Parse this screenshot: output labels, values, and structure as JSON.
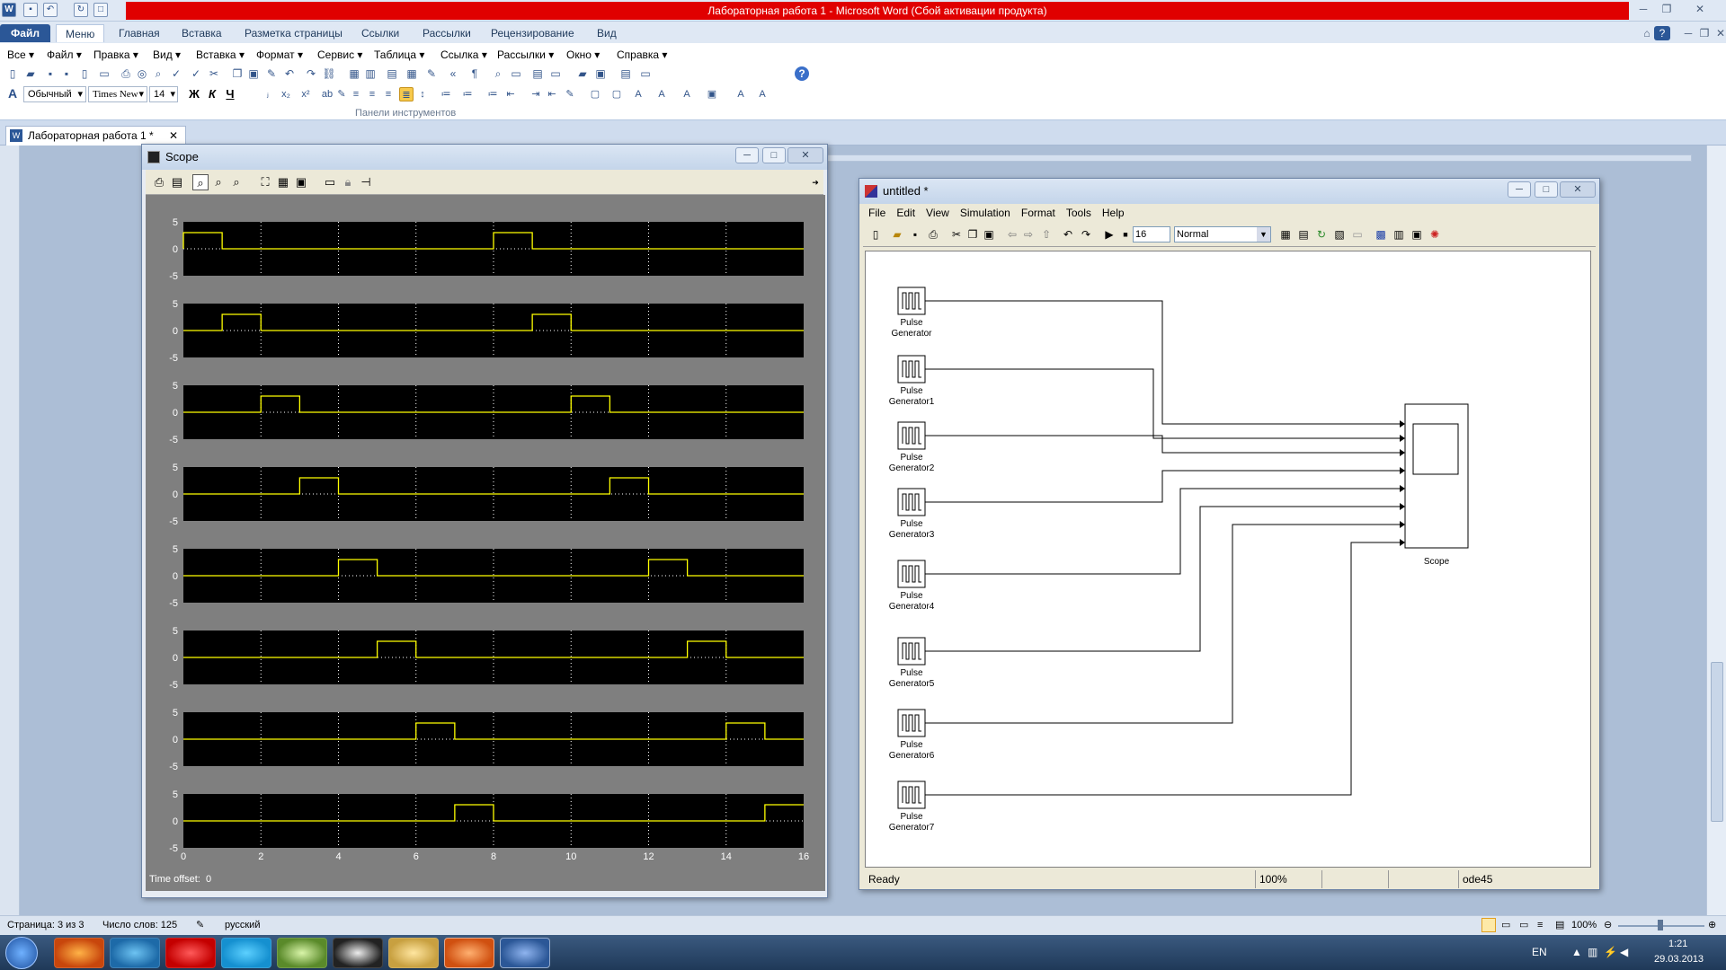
{
  "word": {
    "title": "Лабораторная работа 1  -  Microsoft Word (Сбой активации продукта)",
    "tabs": [
      "Файл",
      "Меню",
      "Главная",
      "Вставка",
      "Разметка страницы",
      "Ссылки",
      "Рассылки",
      "Рецензирование",
      "Вид"
    ],
    "menu_items": [
      "Все",
      "Файл",
      "Правка",
      "Вид",
      "Вставка",
      "Формат",
      "Сервис",
      "Таблица",
      "Ссылка",
      "Рассылки",
      "Окно",
      "Справка"
    ],
    "style_value": "Обычный",
    "font_value": "Times New",
    "size_value": "14",
    "bold_glyph": "Ж",
    "italic_glyph": "К",
    "underline_glyph": "Ч",
    "panel_label": "Панели инструментов",
    "doc_tab": "Лабораторная работа 1  *",
    "status": {
      "page": "Страница: 3 из 3",
      "words": "Число слов: 125",
      "lang": "русский",
      "zoom": "100%"
    }
  },
  "scope": {
    "title": "Scope",
    "time_offset_label": "Time offset:",
    "time_offset_value": "0",
    "y_ticks": [
      "5",
      "0",
      "-5"
    ],
    "x_ticks": [
      "0",
      "2",
      "4",
      "6",
      "8",
      "10",
      "12",
      "14",
      "16"
    ]
  },
  "chart_data": {
    "type": "line",
    "title": "",
    "xlabel": "",
    "ylabel": "",
    "xlim": [
      0,
      16
    ],
    "ylim": [
      -5,
      5
    ],
    "grid": true,
    "line_color": "#ffff00",
    "series": [
      {
        "x": [
          0,
          0,
          1,
          1,
          8,
          8,
          9,
          9,
          16
        ],
        "y": [
          0,
          3,
          3,
          0,
          0,
          3,
          3,
          0,
          0
        ]
      },
      {
        "x": [
          0,
          1,
          1,
          2,
          2,
          9,
          9,
          10,
          10,
          16
        ],
        "y": [
          0,
          0,
          3,
          3,
          0,
          0,
          3,
          3,
          0,
          0
        ]
      },
      {
        "x": [
          0,
          2,
          2,
          3,
          3,
          10,
          10,
          11,
          11,
          16
        ],
        "y": [
          0,
          0,
          3,
          3,
          0,
          0,
          3,
          3,
          0,
          0
        ]
      },
      {
        "x": [
          0,
          3,
          3,
          4,
          4,
          11,
          11,
          12,
          12,
          16
        ],
        "y": [
          0,
          0,
          3,
          3,
          0,
          0,
          3,
          3,
          0,
          0
        ]
      },
      {
        "x": [
          0,
          4,
          4,
          5,
          5,
          12,
          12,
          13,
          13,
          16
        ],
        "y": [
          0,
          0,
          3,
          3,
          0,
          0,
          3,
          3,
          0,
          0
        ]
      },
      {
        "x": [
          0,
          5,
          5,
          6,
          6,
          13,
          13,
          14,
          14,
          16
        ],
        "y": [
          0,
          0,
          3,
          3,
          0,
          0,
          3,
          3,
          0,
          0
        ]
      },
      {
        "x": [
          0,
          6,
          6,
          7,
          7,
          14,
          14,
          15,
          15,
          16
        ],
        "y": [
          0,
          0,
          3,
          3,
          0,
          0,
          3,
          3,
          0,
          0
        ]
      },
      {
        "x": [
          0,
          7,
          7,
          8,
          8,
          15,
          15,
          16
        ],
        "y": [
          0,
          0,
          3,
          3,
          0,
          0,
          3,
          3
        ]
      }
    ]
  },
  "simulink": {
    "title": "untitled *",
    "menu": [
      "File",
      "Edit",
      "View",
      "Simulation",
      "Format",
      "Tools",
      "Help"
    ],
    "stop_time": "16",
    "mode": "Normal",
    "blocks": [
      {
        "l1": "Pulse",
        "l2": "Generator"
      },
      {
        "l1": "Pulse",
        "l2": "Generator1"
      },
      {
        "l1": "Pulse",
        "l2": "Generator2"
      },
      {
        "l1": "Pulse",
        "l2": "Generator3"
      },
      {
        "l1": "Pulse",
        "l2": "Generator4"
      },
      {
        "l1": "Pulse",
        "l2": "Generator5"
      },
      {
        "l1": "Pulse",
        "l2": "Generator6"
      },
      {
        "l1": "Pulse",
        "l2": "Generator7"
      }
    ],
    "scope_label": "Scope",
    "status": {
      "ready": "Ready",
      "zoom": "100%",
      "solver": "ode45"
    }
  },
  "taskbar": {
    "lang": "EN",
    "time": "1:21",
    "date": "29.03.2013"
  }
}
